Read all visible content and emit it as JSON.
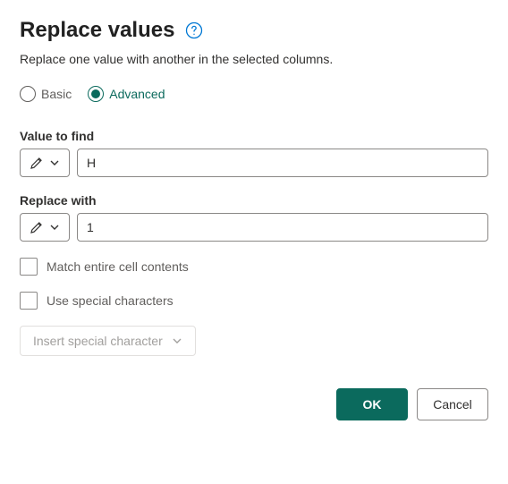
{
  "title": "Replace values",
  "subtitle": "Replace one value with another in the selected columns.",
  "mode": {
    "basic_label": "Basic",
    "advanced_label": "Advanced",
    "selected": "advanced"
  },
  "fields": {
    "value_to_find": {
      "label": "Value to find",
      "value": "H"
    },
    "replace_with": {
      "label": "Replace with",
      "value": "1"
    }
  },
  "options": {
    "match_entire_label": "Match entire cell contents",
    "match_entire_checked": false,
    "use_special_label": "Use special characters",
    "use_special_checked": false,
    "insert_special_label": "Insert special character"
  },
  "buttons": {
    "ok": "OK",
    "cancel": "Cancel"
  }
}
